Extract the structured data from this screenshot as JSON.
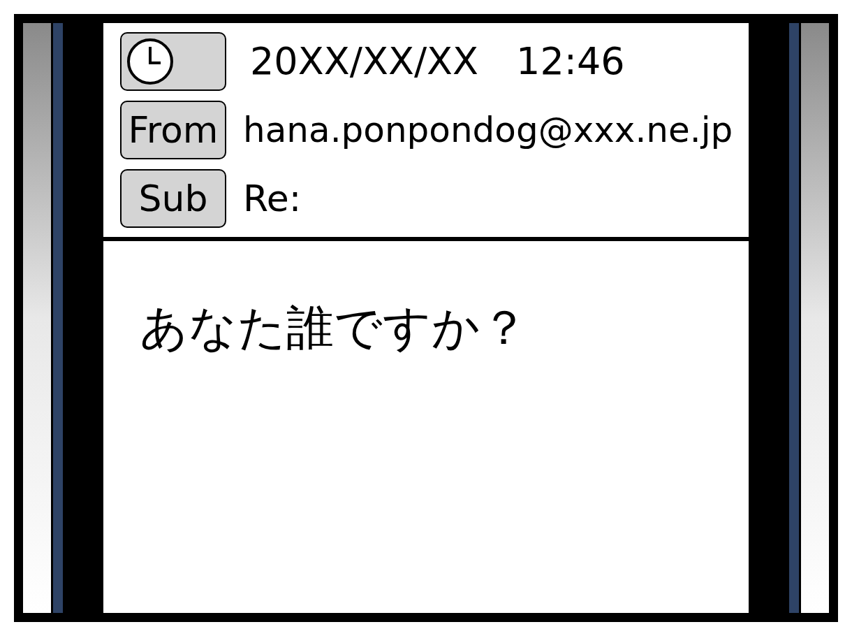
{
  "header": {
    "date": "20XX/XX/XX",
    "time": "12:46",
    "from": {
      "label": "From",
      "value": "hana.ponpondog@xxx.ne.jp"
    },
    "subject": {
      "label": "Sub",
      "value": "Re:"
    }
  },
  "body": {
    "text": "あなた誰ですか？"
  }
}
